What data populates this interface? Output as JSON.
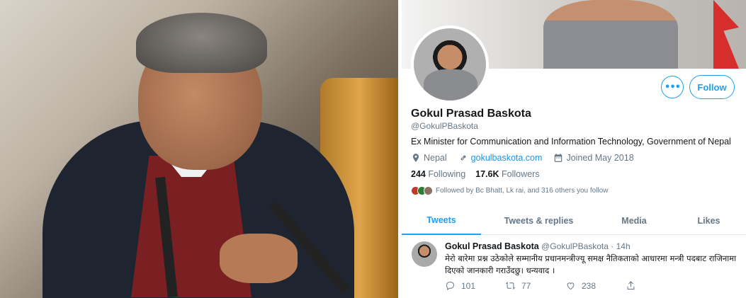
{
  "profile": {
    "name": "Gokul Prasad Baskota",
    "handle": "@GokulPBaskota",
    "bio": "Ex Minister for Communication and Information Technology, Government of Nepal",
    "location": "Nepal",
    "website": "gokulbaskota.com",
    "joined": "Joined May 2018",
    "following_count": "244",
    "following_label": "Following",
    "followers_count": "17.6K",
    "followers_label": "Followers",
    "followed_by": "Followed by Bc Bhatt, Lk rai, and 316 others you follow",
    "follow_label": "Follow",
    "more_label": "•••"
  },
  "tabs": [
    {
      "label": "Tweets",
      "active": true
    },
    {
      "label": "Tweets & replies",
      "active": false
    },
    {
      "label": "Media",
      "active": false
    },
    {
      "label": "Likes",
      "active": false
    }
  ],
  "tweet": {
    "author": "Gokul Prasad Baskota",
    "handle_time": "@GokulPBaskota · 14h",
    "text": "मेरो बारेमा प्रश्न उठेकोले सम्मानीय प्रधानमन्त्रीज्यू समक्ष  नैतिकताको आधारमा मन्त्री पदबाट राजिनामा दिएको जानकारी गराउँदछु। धन्यवाद ।",
    "replies": "101",
    "retweets": "77",
    "likes": "238"
  },
  "icons": {
    "location": "location-pin-icon",
    "link": "link-icon",
    "calendar": "calendar-icon",
    "reply": "reply-icon",
    "retweet": "retweet-icon",
    "like": "heart-icon",
    "share": "share-icon"
  },
  "colors": {
    "accent": "#1da1f2",
    "text": "#14171a",
    "muted": "#657786"
  }
}
